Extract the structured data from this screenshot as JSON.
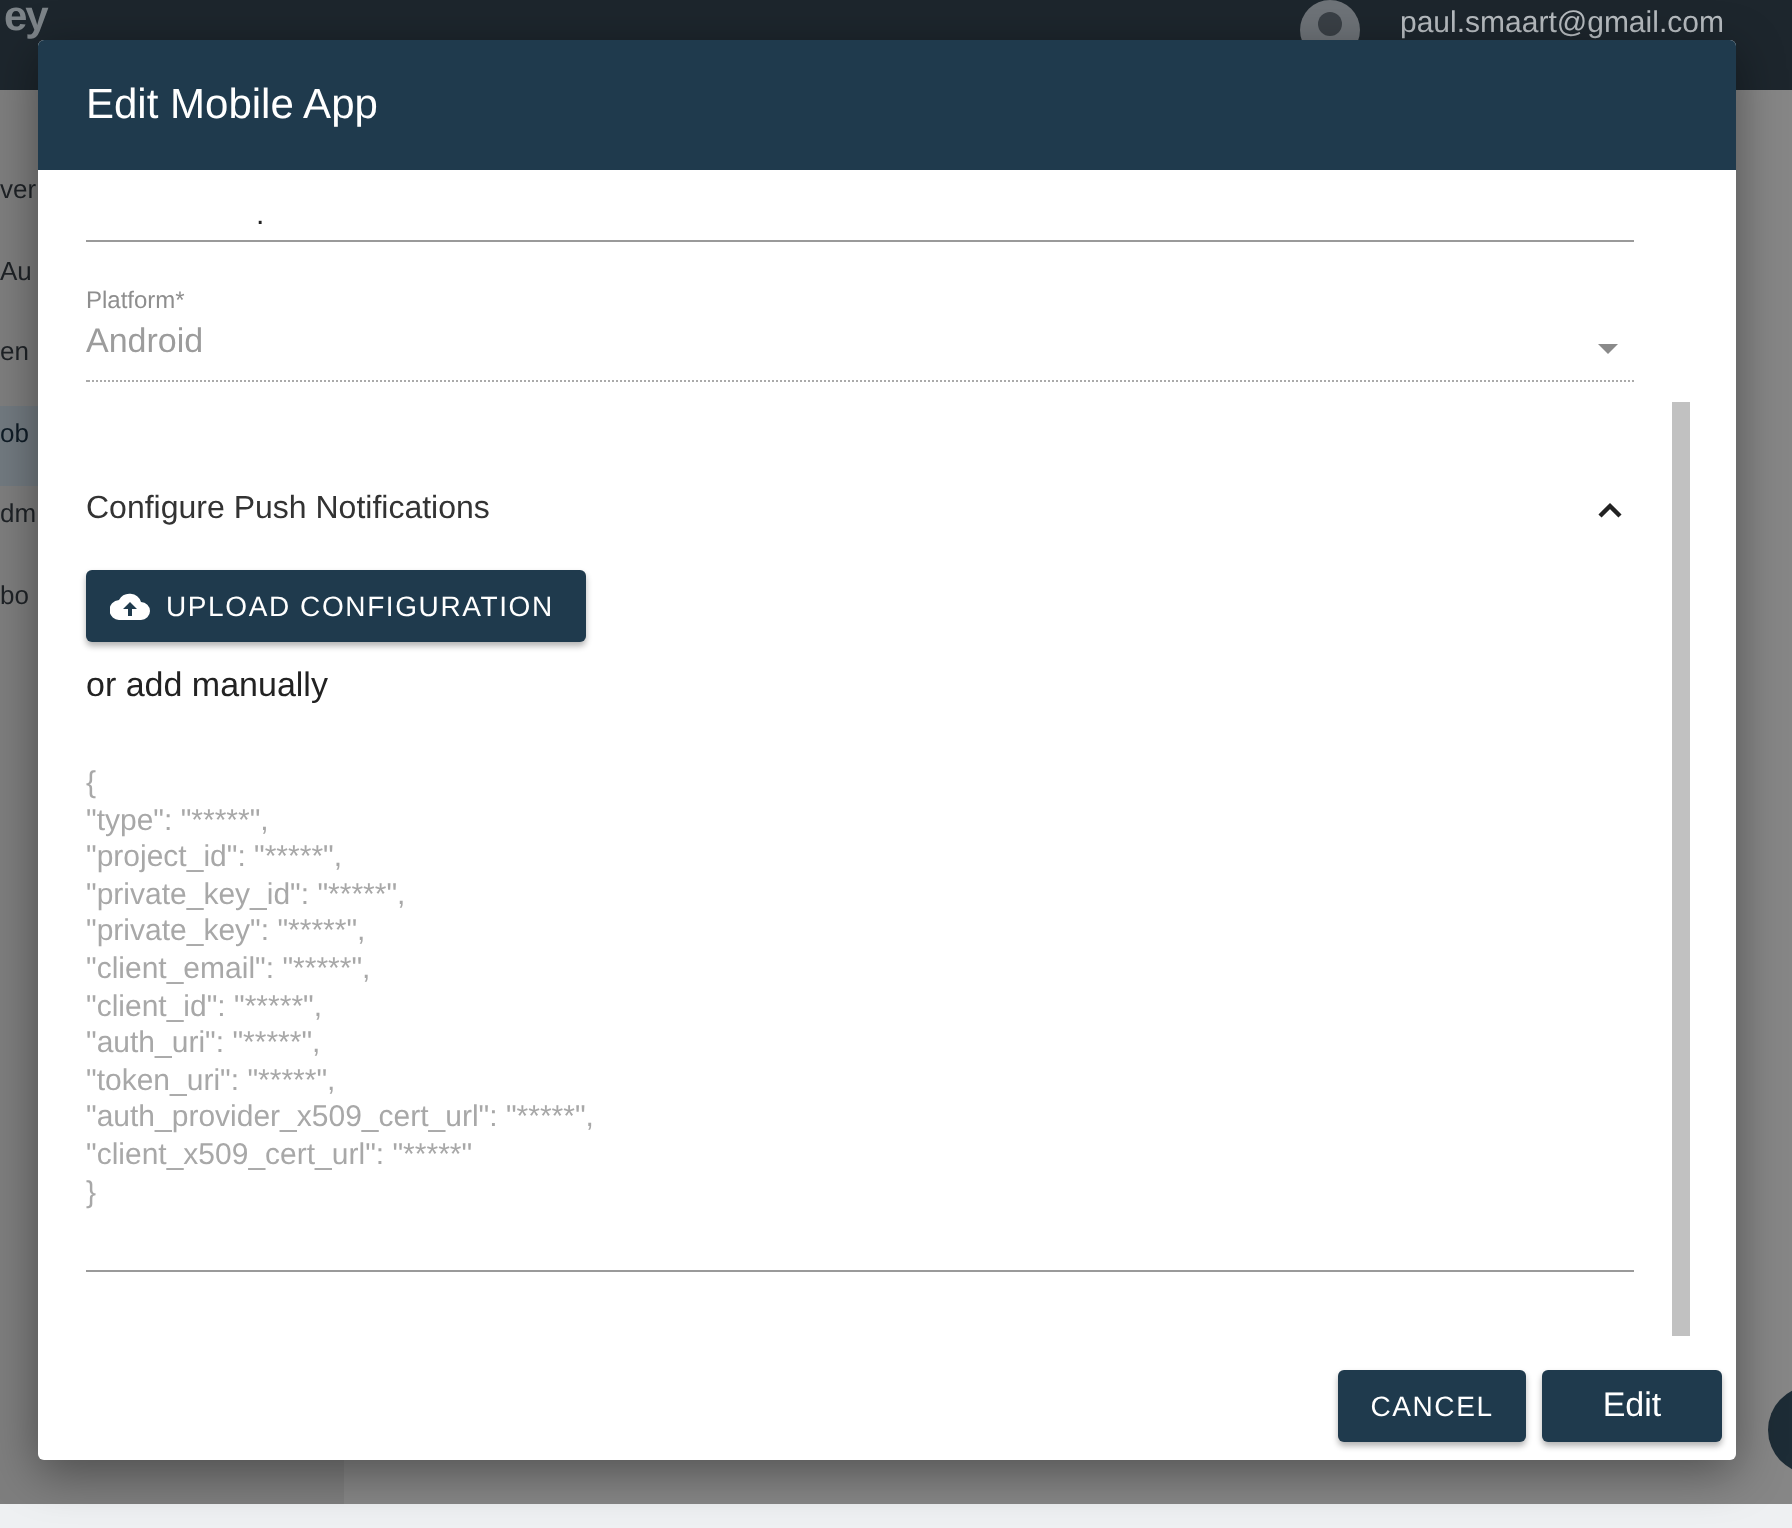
{
  "app_bar": {
    "logo": "ey",
    "user_email": "paul.smaart@gmail.com"
  },
  "sidebar": {
    "items": [
      {
        "label": "ver",
        "selected": false
      },
      {
        "label": "Au",
        "selected": false
      },
      {
        "label": "en",
        "selected": false
      },
      {
        "label": "ob",
        "selected": true
      },
      {
        "label": "dm",
        "selected": false
      },
      {
        "label": "bo",
        "selected": false
      }
    ]
  },
  "dialog": {
    "title": "Edit Mobile App",
    "name_field": {
      "value": "."
    },
    "platform_field": {
      "label": "Platform*",
      "value": "Android",
      "disabled": true
    },
    "section": {
      "title": "Configure Push Notifications",
      "expanded": true
    },
    "upload_button": "UPLOAD CONFIGURATION",
    "manual_text": "or add manually",
    "config_field": {
      "placeholder": "{\n\"type\": \"*****\",\n\"project_id\": \"*****\",\n\"private_key_id\": \"*****\",\n\"private_key\": \"*****\",\n\"client_email\": \"*****\",\n\"client_id\": \"*****\",\n\"auth_uri\": \"*****\",\n\"token_uri\": \"*****\",\n\"auth_provider_x509_cert_url\": \"*****\",\n\"client_x509_cert_url\": \"*****\"\n}"
    },
    "buttons": [
      "CANCEL",
      "Edit"
    ]
  }
}
